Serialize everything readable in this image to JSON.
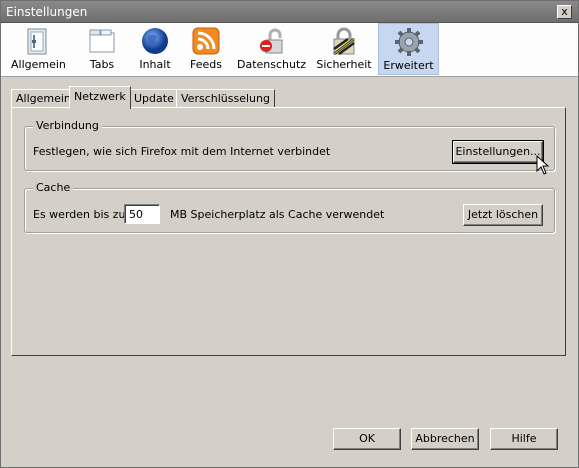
{
  "window": {
    "title": "Einstellungen",
    "close_glyph": "x"
  },
  "toolbar": {
    "panes": [
      {
        "label": "Allgemein",
        "icon": "general-icon"
      },
      {
        "label": "Tabs",
        "icon": "tabs-icon"
      },
      {
        "label": "Inhalt",
        "icon": "globe-icon"
      },
      {
        "label": "Feeds",
        "icon": "rss-icon"
      },
      {
        "label": "Datenschutz",
        "icon": "padlock-icon"
      },
      {
        "label": "Sicherheit",
        "icon": "lock-icon"
      },
      {
        "label": "Erweitert",
        "icon": "gear-icon",
        "active": true
      }
    ]
  },
  "tabs": [
    {
      "label": "Allgemein"
    },
    {
      "label": "Netzwerk",
      "active": true
    },
    {
      "label": "Update"
    },
    {
      "label": "Verschlüsselung"
    }
  ],
  "connection": {
    "legend": "Verbindung",
    "description": "Festlegen, wie sich Firefox mit dem Internet verbindet",
    "settings_button": "Einstellungen..."
  },
  "cache": {
    "legend": "Cache",
    "label_before": "Es werden bis zu",
    "value": "50",
    "label_after": "MB Speicherplatz als Cache verwendet",
    "clear_button": "Jetzt löschen"
  },
  "footer": {
    "ok": "OK",
    "cancel": "Abbrechen",
    "help": "Hilfe"
  },
  "colors": {
    "active_pane": "#c6d7ef",
    "titlebar": "#7a7a7a"
  }
}
